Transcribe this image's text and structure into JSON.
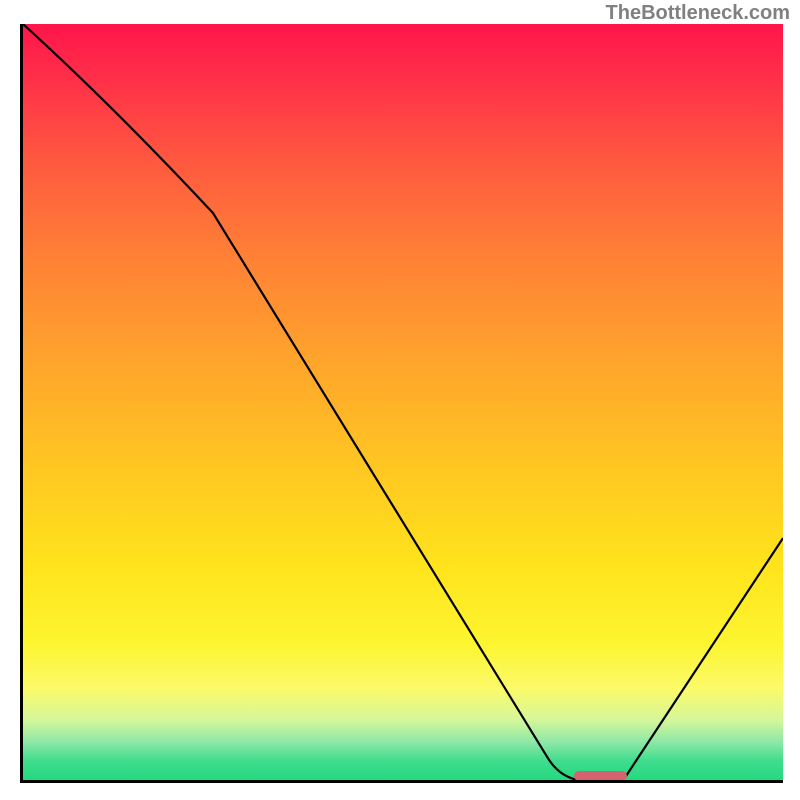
{
  "watermark": "TheBottleneck.com",
  "chart_data": {
    "type": "line",
    "title": "",
    "xlabel": "",
    "ylabel": "",
    "xlim": [
      0,
      100
    ],
    "ylim": [
      0,
      100
    ],
    "grid": false,
    "legend": false,
    "series": [
      {
        "name": "curve",
        "x": [
          0,
          25,
          69,
          73,
          79,
          100
        ],
        "y": [
          100,
          75,
          3,
          0,
          0,
          32
        ]
      }
    ],
    "marker": {
      "x_start": 73,
      "x_end": 79,
      "y": 0
    },
    "background_gradient_stops": [
      {
        "pct": 0,
        "color": "#ff154a"
      },
      {
        "pct": 18,
        "color": "#ff5840"
      },
      {
        "pct": 44,
        "color": "#ffa32c"
      },
      {
        "pct": 72,
        "color": "#ffe41c"
      },
      {
        "pct": 88,
        "color": "#fbfa6a"
      },
      {
        "pct": 95,
        "color": "#8de8a6"
      },
      {
        "pct": 100,
        "color": "#23d97f"
      }
    ]
  }
}
